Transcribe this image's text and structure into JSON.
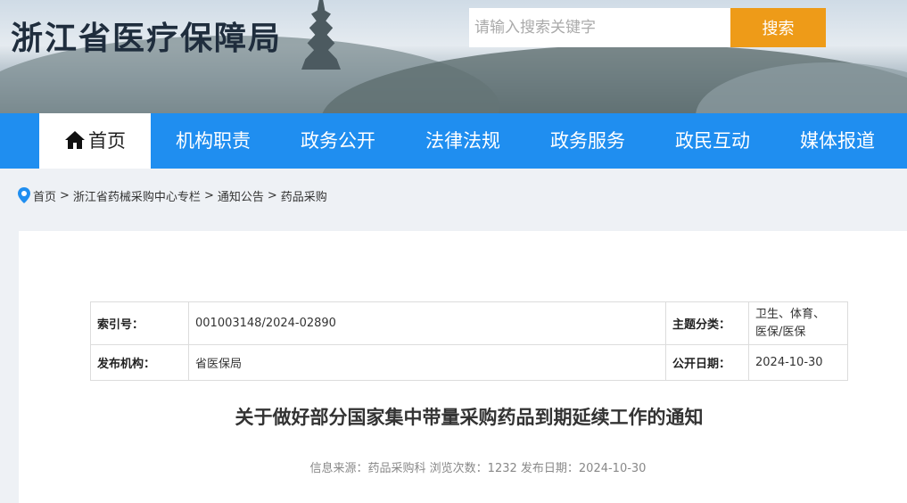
{
  "header": {
    "site_title": "浙江省医疗保障局",
    "search_placeholder": "请输入搜索关键字",
    "search_button": "搜索"
  },
  "nav": {
    "items": [
      {
        "label": "首页",
        "active": true,
        "icon": "home-icon"
      },
      {
        "label": "机构职责"
      },
      {
        "label": "政务公开"
      },
      {
        "label": "法律法规"
      },
      {
        "label": "政务服务"
      },
      {
        "label": "政民互动"
      },
      {
        "label": "媒体报道"
      }
    ]
  },
  "breadcrumb": {
    "icon": "location-pin-icon",
    "items": [
      "首页",
      "浙江省药械采购中心专栏",
      "通知公告",
      "药品采购"
    ],
    "separator": ">"
  },
  "meta": {
    "index_label": "索引号：",
    "index_value": "001003148/2024-02890",
    "topic_label": "主题分类：",
    "topic_value_line1": "卫生、体育、",
    "topic_value_line2": "医保/医保",
    "publisher_label": "发布机构：",
    "publisher_value": "省医保局",
    "date_label": "公开日期：",
    "date_value": "2024-10-30"
  },
  "article": {
    "title": "关于做好部分国家集中带量采购药品到期延续工作的通知",
    "info": "信息来源：药品采购科 浏览次数：1232 发布日期：2024-10-30"
  },
  "colors": {
    "nav_bg": "#1f8ef0",
    "search_button_bg": "#ee9b18",
    "page_bg": "#eef1f5"
  }
}
